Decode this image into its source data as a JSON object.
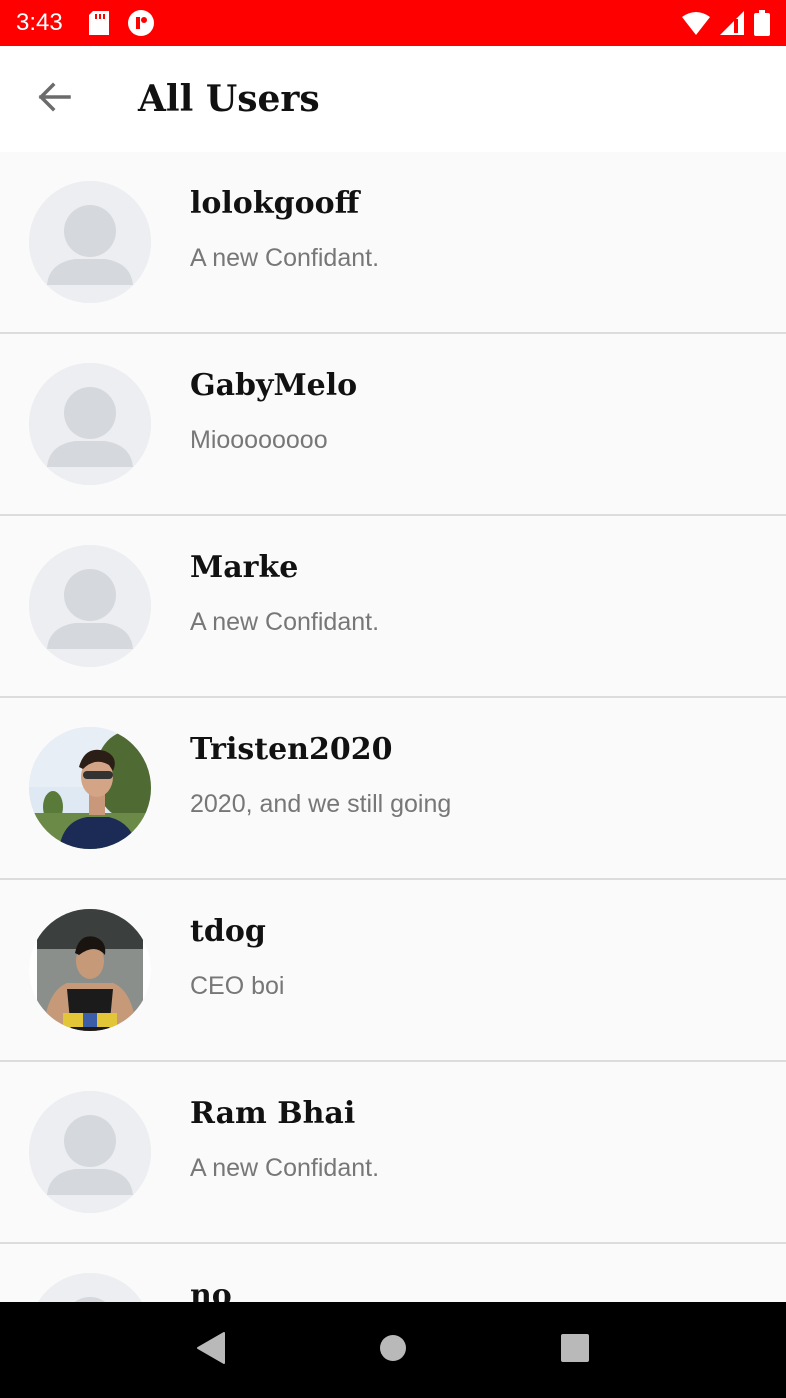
{
  "status_bar": {
    "time": "3:43",
    "background": "#ff0000",
    "icons": [
      "sd-card-icon",
      "app-notification-icon",
      "wifi-icon",
      "signal-icon",
      "battery-icon"
    ]
  },
  "app_bar": {
    "title": "All Users",
    "back_icon": "arrow-back-icon"
  },
  "users": [
    {
      "name": "lolokgooff",
      "status": "A new Confidant.",
      "avatar": "default-avatar"
    },
    {
      "name": "GabyMelo",
      "status": "Mioooooooo",
      "avatar": "default-avatar"
    },
    {
      "name": "Marke",
      "status": "A new Confidant.",
      "avatar": "default-avatar"
    },
    {
      "name": "Tristen2020",
      "status": "2020, and we still going",
      "avatar": "photo-avatar"
    },
    {
      "name": "tdog",
      "status": "CEO boi",
      "avatar": "photo-avatar"
    },
    {
      "name": "Ram Bhai",
      "status": "A new Confidant.",
      "avatar": "default-avatar"
    },
    {
      "name": "no",
      "status": "",
      "avatar": "default-avatar"
    }
  ],
  "nav_bar": {
    "buttons": [
      "back-triangle-icon",
      "home-circle-icon",
      "recents-square-icon"
    ]
  }
}
